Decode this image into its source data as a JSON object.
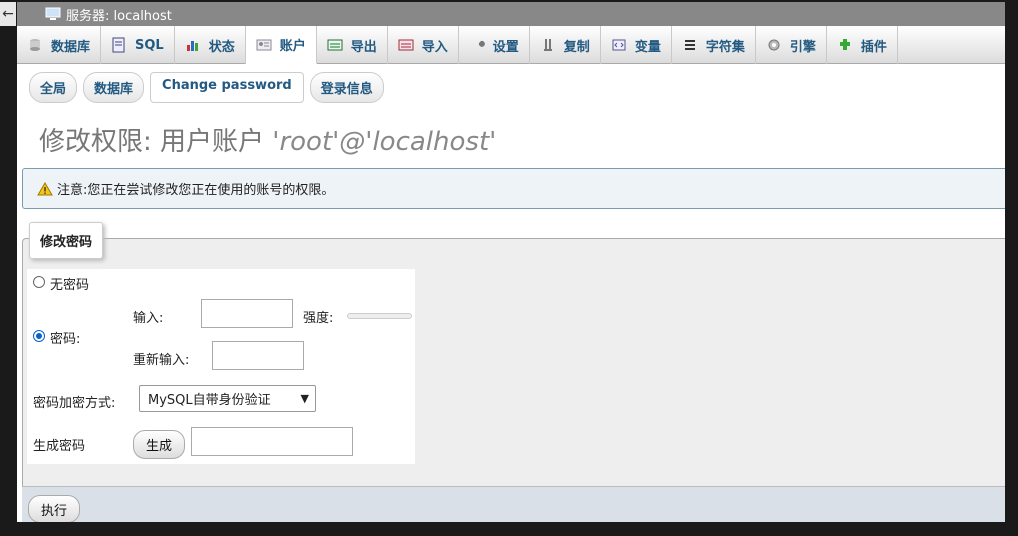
{
  "window": {
    "collapse_symbol": "←",
    "title": "服务器:  localhost"
  },
  "tabs": [
    {
      "label": "数据库",
      "icon": "database-icon"
    },
    {
      "label": "SQL",
      "icon": "sql-icon"
    },
    {
      "label": "状态",
      "icon": "status-icon"
    },
    {
      "label": "账户",
      "icon": "accounts-icon",
      "active": true
    },
    {
      "label": "导出",
      "icon": "export-icon"
    },
    {
      "label": "导入",
      "icon": "import-icon"
    },
    {
      "label": "设置",
      "icon": "wrench-icon"
    },
    {
      "label": "复制",
      "icon": "replication-icon"
    },
    {
      "label": "变量",
      "icon": "variables-icon"
    },
    {
      "label": "字符集",
      "icon": "charset-icon"
    },
    {
      "label": "引擎",
      "icon": "engine-icon"
    },
    {
      "label": "插件",
      "icon": "plugin-icon"
    }
  ],
  "subnav": [
    {
      "label": "全局"
    },
    {
      "label": "数据库"
    },
    {
      "label": "Change password",
      "active": true
    },
    {
      "label": "登录信息"
    }
  ],
  "page": {
    "title_prefix": "修改权限:  用户账户",
    "title_user": "'root'@'localhost'"
  },
  "notice": {
    "text": "注意:您正在尝试修改您正在使用的账号的权限。"
  },
  "password_form": {
    "legend": "修改密码",
    "no_password_label": "无密码",
    "password_label": "密码:",
    "enter_label": "输入:",
    "strength_label": "强度:",
    "reenter_label": "重新输入:",
    "hashing_label": "密码加密方式:",
    "hashing_value": "MySQL自带身份验证",
    "generate_label": "生成密码",
    "generate_button": "生成"
  },
  "footer": {
    "submit_button": "执行"
  },
  "colors": {
    "accent": "#235a81",
    "notice_border": "#7a9cae",
    "title": "#777777"
  }
}
